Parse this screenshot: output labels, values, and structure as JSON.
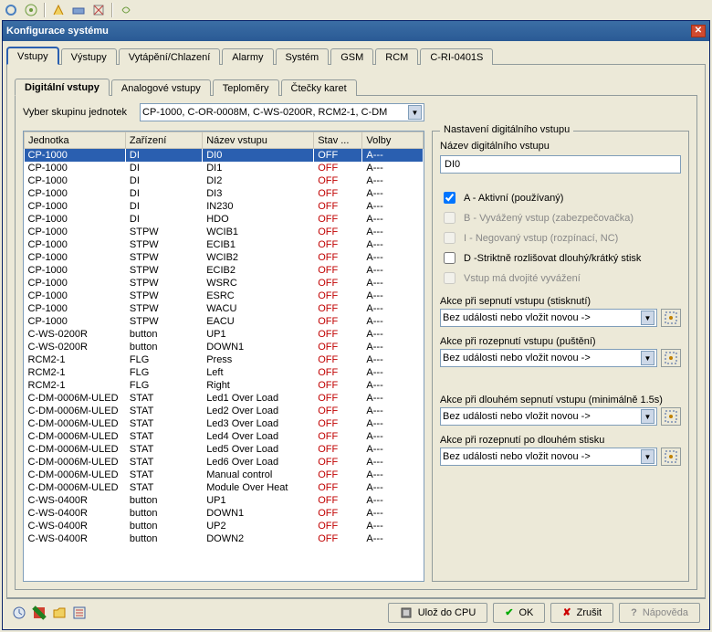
{
  "window": {
    "title": "Konfigurace systému"
  },
  "mainTabs": [
    "Vstupy",
    "Výstupy",
    "Vytápění/Chlazení",
    "Alarmy",
    "Systém",
    "GSM",
    "RCM",
    "C-RI-0401S"
  ],
  "subTabs": [
    "Digitální vstupy",
    "Analogové vstupy",
    "Teploměry",
    "Čtečky karet"
  ],
  "groupSelect": {
    "label": "Vyber skupinu jednotek",
    "value": "CP-1000, C-OR-0008M, C-WS-0200R, RCM2-1, C-DM"
  },
  "gridHeaders": [
    "Jednotka",
    "Zařízení",
    "Název vstupu",
    "Stav ...",
    "Volby"
  ],
  "gridColWidths": [
    100,
    76,
    110,
    48,
    60
  ],
  "rows": [
    {
      "u": "CP-1000",
      "z": "DI",
      "n": "DI0",
      "s": "OFF",
      "v": "A---",
      "sel": true
    },
    {
      "u": "CP-1000",
      "z": "DI",
      "n": "DI1",
      "s": "OFF",
      "v": "A---"
    },
    {
      "u": "CP-1000",
      "z": "DI",
      "n": "DI2",
      "s": "OFF",
      "v": "A---"
    },
    {
      "u": "CP-1000",
      "z": "DI",
      "n": "DI3",
      "s": "OFF",
      "v": "A---"
    },
    {
      "u": "CP-1000",
      "z": "DI",
      "n": "IN230",
      "s": "OFF",
      "v": "A---"
    },
    {
      "u": "CP-1000",
      "z": "DI",
      "n": "HDO",
      "s": "OFF",
      "v": "A---"
    },
    {
      "u": "CP-1000",
      "z": "STPW",
      "n": "WCIB1",
      "s": "OFF",
      "v": "A---"
    },
    {
      "u": "CP-1000",
      "z": "STPW",
      "n": "ECIB1",
      "s": "OFF",
      "v": "A---"
    },
    {
      "u": "CP-1000",
      "z": "STPW",
      "n": "WCIB2",
      "s": "OFF",
      "v": "A---"
    },
    {
      "u": "CP-1000",
      "z": "STPW",
      "n": "ECIB2",
      "s": "OFF",
      "v": "A---"
    },
    {
      "u": "CP-1000",
      "z": "STPW",
      "n": "WSRC",
      "s": "OFF",
      "v": "A---"
    },
    {
      "u": "CP-1000",
      "z": "STPW",
      "n": "ESRC",
      "s": "OFF",
      "v": "A---"
    },
    {
      "u": "CP-1000",
      "z": "STPW",
      "n": "WACU",
      "s": "OFF",
      "v": "A---"
    },
    {
      "u": "CP-1000",
      "z": "STPW",
      "n": "EACU",
      "s": "OFF",
      "v": "A---"
    },
    {
      "u": "C-WS-0200R",
      "z": "button",
      "n": "UP1",
      "s": "OFF",
      "v": "A---"
    },
    {
      "u": "C-WS-0200R",
      "z": "button",
      "n": "DOWN1",
      "s": "OFF",
      "v": "A---"
    },
    {
      "u": "RCM2-1",
      "z": "FLG",
      "n": "Press",
      "s": "OFF",
      "v": "A---"
    },
    {
      "u": "RCM2-1",
      "z": "FLG",
      "n": "Left",
      "s": "OFF",
      "v": "A---"
    },
    {
      "u": "RCM2-1",
      "z": "FLG",
      "n": "Right",
      "s": "OFF",
      "v": "A---"
    },
    {
      "u": "C-DM-0006M-ULED",
      "z": "STAT",
      "n": "Led1 Over Load",
      "s": "OFF",
      "v": "A---"
    },
    {
      "u": "C-DM-0006M-ULED",
      "z": "STAT",
      "n": "Led2 Over Load",
      "s": "OFF",
      "v": "A---"
    },
    {
      "u": "C-DM-0006M-ULED",
      "z": "STAT",
      "n": "Led3 Over Load",
      "s": "OFF",
      "v": "A---"
    },
    {
      "u": "C-DM-0006M-ULED",
      "z": "STAT",
      "n": "Led4 Over Load",
      "s": "OFF",
      "v": "A---"
    },
    {
      "u": "C-DM-0006M-ULED",
      "z": "STAT",
      "n": "Led5 Over Load",
      "s": "OFF",
      "v": "A---"
    },
    {
      "u": "C-DM-0006M-ULED",
      "z": "STAT",
      "n": "Led6 Over Load",
      "s": "OFF",
      "v": "A---"
    },
    {
      "u": "C-DM-0006M-ULED",
      "z": "STAT",
      "n": "Manual control",
      "s": "OFF",
      "v": "A---"
    },
    {
      "u": "C-DM-0006M-ULED",
      "z": "STAT",
      "n": "Module Over Heat",
      "s": "OFF",
      "v": "A---"
    },
    {
      "u": "C-WS-0400R",
      "z": "button",
      "n": "UP1",
      "s": "OFF",
      "v": "A---"
    },
    {
      "u": "C-WS-0400R",
      "z": "button",
      "n": "DOWN1",
      "s": "OFF",
      "v": "A---"
    },
    {
      "u": "C-WS-0400R",
      "z": "button",
      "n": "UP2",
      "s": "OFF",
      "v": "A---"
    },
    {
      "u": "C-WS-0400R",
      "z": "button",
      "n": "DOWN2",
      "s": "OFF",
      "v": "A---"
    }
  ],
  "rightPanel": {
    "legend": "Nastavení digitálního vstupu",
    "nameLabel": "Název digitálního vstupu",
    "nameValue": "DI0",
    "optA": "A - Aktivní (používaný)",
    "optB": "B - Vyvážený vstup (zabezpečovačka)",
    "optI": "I - Negovaný vstup (rozpínací, NC)",
    "optD": "D -Striktně rozlišovat dlouhý/krátký stisk",
    "optDouble": "Vstup má dvojité vyvážení",
    "actionPress": "Akce při sepnutí vstupu (stisknutí)",
    "actionRelease": "Akce při rozepnutí vstupu (puštění)",
    "actionLongPress": "Akce při dlouhém sepnutí vstupu (minimálně 1.5s)",
    "actionLongRelease": "Akce při rozepnutí po dlouhém stisku",
    "comboValue": "Bez události nebo vložit novou ->"
  },
  "buttons": {
    "save": "Ulož do CPU",
    "ok": "OK",
    "cancel": "Zrušit",
    "help": "Nápověda"
  }
}
